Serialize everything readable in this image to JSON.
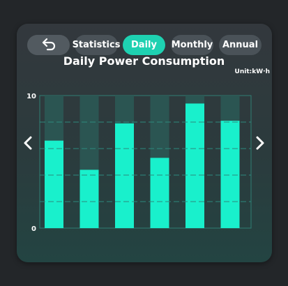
{
  "nav": {
    "back_icon": "undo-arrow-icon",
    "tabs": [
      {
        "label": "Statistics",
        "active": false
      },
      {
        "label": "Daily",
        "active": true
      },
      {
        "label": "Monthly",
        "active": false
      },
      {
        "label": "Annual",
        "active": false
      }
    ]
  },
  "chart_data": {
    "type": "bar",
    "title": "Daily Power Consumption",
    "unit": "Unit:kW·h",
    "ylim": [
      0,
      10
    ],
    "y_ticks": [
      "0",
      "10"
    ],
    "values": [
      6.6,
      4.4,
      7.9,
      5.3,
      9.4,
      8.1
    ],
    "bar_color": "#19f0cc",
    "track_color": "#2b5552",
    "grid": true
  },
  "arrows": {
    "prev_icon": "chevron-left-icon",
    "next_icon": "chevron-right-icon"
  },
  "colors": {
    "accent": "#1ed1b1",
    "tab_bg": "#4a5258"
  }
}
